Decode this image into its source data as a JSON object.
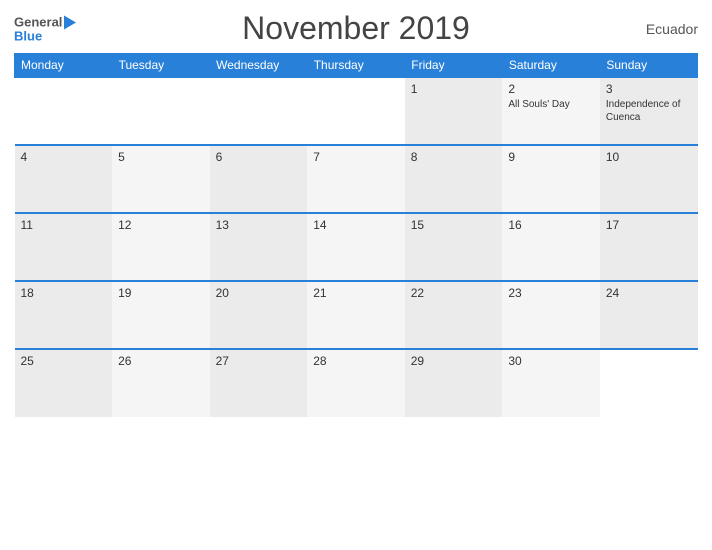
{
  "header": {
    "logo_general": "General",
    "logo_blue": "Blue",
    "title": "November 2019",
    "country": "Ecuador"
  },
  "calendar": {
    "days_of_week": [
      "Monday",
      "Tuesday",
      "Wednesday",
      "Thursday",
      "Friday",
      "Saturday",
      "Sunday"
    ],
    "weeks": [
      [
        {
          "day": "",
          "event": ""
        },
        {
          "day": "",
          "event": ""
        },
        {
          "day": "",
          "event": ""
        },
        {
          "day": "",
          "event": ""
        },
        {
          "day": "1",
          "event": ""
        },
        {
          "day": "2",
          "event": "All Souls' Day"
        },
        {
          "day": "3",
          "event": "Independence of Cuenca"
        }
      ],
      [
        {
          "day": "4",
          "event": ""
        },
        {
          "day": "5",
          "event": ""
        },
        {
          "day": "6",
          "event": ""
        },
        {
          "day": "7",
          "event": ""
        },
        {
          "day": "8",
          "event": ""
        },
        {
          "day": "9",
          "event": ""
        },
        {
          "day": "10",
          "event": ""
        }
      ],
      [
        {
          "day": "11",
          "event": ""
        },
        {
          "day": "12",
          "event": ""
        },
        {
          "day": "13",
          "event": ""
        },
        {
          "day": "14",
          "event": ""
        },
        {
          "day": "15",
          "event": ""
        },
        {
          "day": "16",
          "event": ""
        },
        {
          "day": "17",
          "event": ""
        }
      ],
      [
        {
          "day": "18",
          "event": ""
        },
        {
          "day": "19",
          "event": ""
        },
        {
          "day": "20",
          "event": ""
        },
        {
          "day": "21",
          "event": ""
        },
        {
          "day": "22",
          "event": ""
        },
        {
          "day": "23",
          "event": ""
        },
        {
          "day": "24",
          "event": ""
        }
      ],
      [
        {
          "day": "25",
          "event": ""
        },
        {
          "day": "26",
          "event": ""
        },
        {
          "day": "27",
          "event": ""
        },
        {
          "day": "28",
          "event": ""
        },
        {
          "day": "29",
          "event": ""
        },
        {
          "day": "30",
          "event": ""
        },
        {
          "day": "",
          "event": ""
        }
      ]
    ]
  }
}
